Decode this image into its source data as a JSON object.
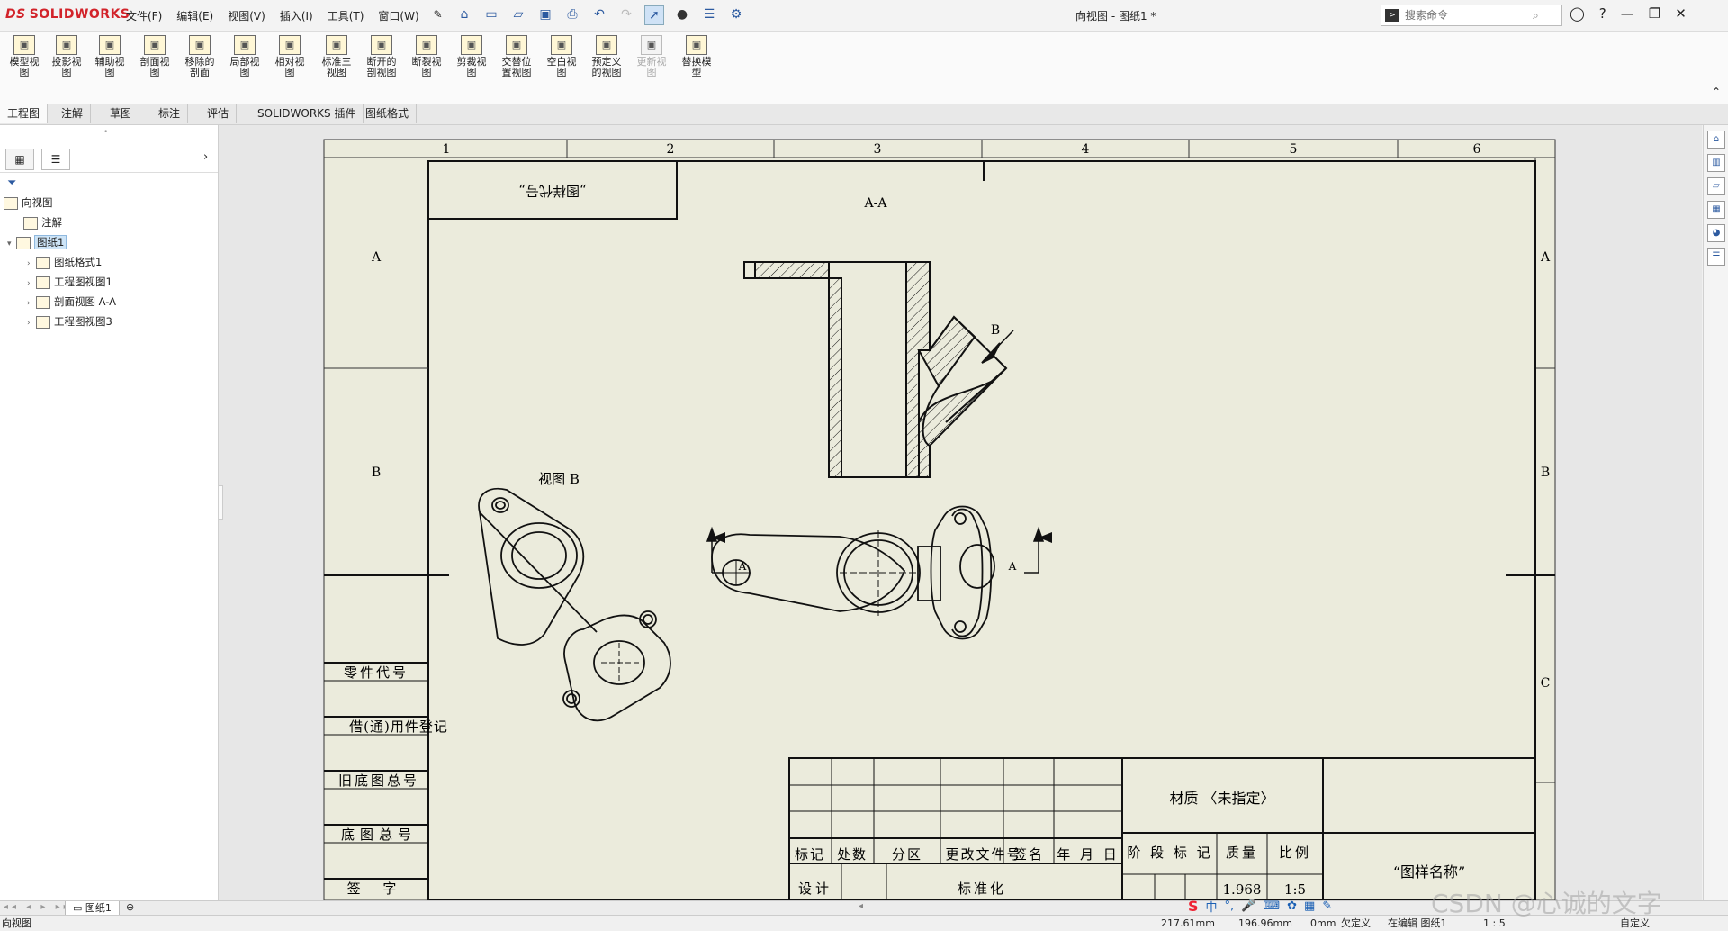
{
  "app": {
    "name": "SOLIDWORKS",
    "logo_prefix": "DS",
    "document_title": "向视图 - 图纸1 *"
  },
  "menu": [
    "文件(F)",
    "编辑(E)",
    "视图(V)",
    "插入(I)",
    "工具(T)",
    "窗口(W)"
  ],
  "search": {
    "placeholder": "搜索命令"
  },
  "ribbon": [
    {
      "label1": "模型视",
      "label2": "图",
      "icon": "model-view-icon",
      "enabled": true
    },
    {
      "label1": "投影视",
      "label2": "图",
      "icon": "projected-view-icon",
      "enabled": true
    },
    {
      "label1": "辅助视",
      "label2": "图",
      "icon": "auxiliary-view-icon",
      "enabled": true
    },
    {
      "label1": "剖面视",
      "label2": "图",
      "icon": "section-view-icon",
      "enabled": true
    },
    {
      "label1": "移除的",
      "label2": "剖面",
      "icon": "removed-section-icon",
      "enabled": true
    },
    {
      "label1": "局部视",
      "label2": "图",
      "icon": "detail-view-icon",
      "enabled": true
    },
    {
      "label1": "相对视",
      "label2": "图",
      "icon": "relative-view-icon",
      "enabled": true
    },
    {
      "label1": "标准三",
      "label2": "视图",
      "icon": "standard-3-view-icon",
      "enabled": true
    },
    {
      "label1": "断开的",
      "label2": "剖视图",
      "icon": "broken-out-section-icon",
      "enabled": true
    },
    {
      "label1": "断裂视",
      "label2": "图",
      "icon": "break-view-icon",
      "enabled": true
    },
    {
      "label1": "剪裁视",
      "label2": "图",
      "icon": "crop-view-icon",
      "enabled": true
    },
    {
      "label1": "交替位",
      "label2": "置视图",
      "icon": "alternate-position-icon",
      "enabled": true
    },
    {
      "label1": "空白视",
      "label2": "图",
      "icon": "empty-view-icon",
      "enabled": true
    },
    {
      "label1": "预定义",
      "label2": "的视图",
      "icon": "predefined-view-icon",
      "enabled": true
    },
    {
      "label1": "更新视",
      "label2": "图",
      "icon": "update-view-icon",
      "enabled": false
    },
    {
      "label1": "替换模",
      "label2": "型",
      "icon": "replace-model-icon",
      "enabled": true
    }
  ],
  "tabs": [
    "工程图",
    "注解",
    "草图",
    "标注",
    "评估",
    "SOLIDWORKS 插件",
    "图纸格式"
  ],
  "tree": {
    "root": "向视图",
    "annotations": "注解",
    "sheet": "图纸1",
    "children": [
      "图纸格式1",
      "工程图视图1",
      "剖面视图 A-A",
      "工程图视图3"
    ]
  },
  "drawing": {
    "col_numbers": [
      "1",
      "2",
      "3",
      "4",
      "5",
      "6"
    ],
    "row_letters": [
      "A",
      "B",
      "C"
    ],
    "code_box": "„图样代号„",
    "section_label": "A-A",
    "view_b_label": "视图 B",
    "arrow_b": "B",
    "arrow_a1": "A",
    "arrow_a2": "A",
    "left_block": [
      "零件代号",
      "借(通)用件登记",
      "旧底图总号",
      "底图总号",
      "签 字"
    ],
    "title_block": {
      "material": "材质 〈未指定〉",
      "headers": [
        "标记",
        "处数",
        "分区",
        "更改文件号",
        "签名",
        "年 月 日"
      ],
      "stage": "阶 段 标 记",
      "mass_label": "质量",
      "scale_label": "比例",
      "mass": "1.968",
      "scale": "1:5",
      "design": "设计",
      "standard": "标准化",
      "drawing_name": "“图样名称”"
    }
  },
  "sheet_tab": "图纸1",
  "status": {
    "left": "向视图",
    "x": "217.61mm",
    "y": "196.96mm",
    "z": "0mm",
    "defined": "欠定义",
    "editing": "在编辑 图纸1",
    "scale": "1 : 5",
    "custom": "自定义"
  },
  "ime": [
    "中",
    "°,",
    "🎤"
  ],
  "watermark": "CSDN @心诚的文字"
}
